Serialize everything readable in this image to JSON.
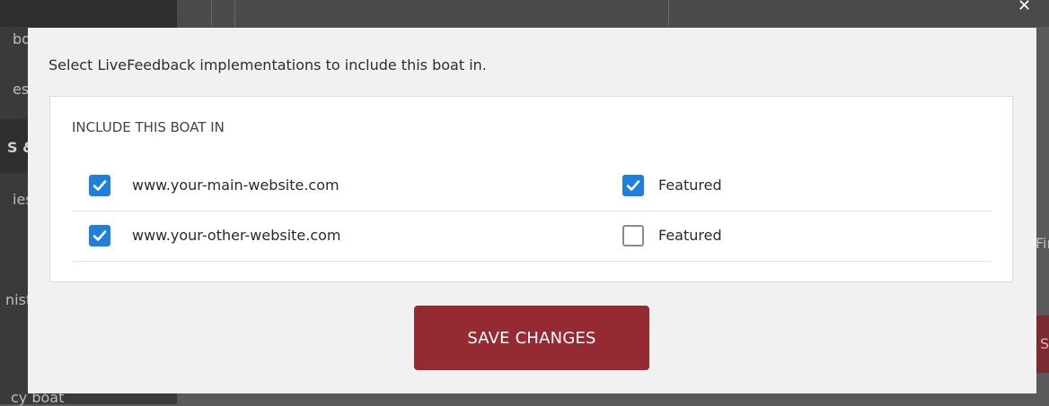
{
  "background": {
    "sidebar_fragments": [
      "bo",
      "es",
      "S &",
      "ies",
      "nist",
      "cy boat"
    ],
    "right_fragment": "Fir",
    "right_button_fragment": "S"
  },
  "modal": {
    "intro_text": "Select LiveFeedback implementations to include this boat in.",
    "section_title": "INCLUDE THIS BOAT IN",
    "rows": [
      {
        "site": "www.your-main-website.com",
        "site_checked": true,
        "featured_label": "Featured",
        "featured_checked": true
      },
      {
        "site": "www.your-other-website.com",
        "site_checked": true,
        "featured_label": "Featured",
        "featured_checked": false
      }
    ],
    "save_label": "SAVE CHANGES"
  },
  "colors": {
    "accent_checkbox": "#1e7fe0",
    "save_button": "#952a33",
    "modal_bg": "#f1f1f1"
  }
}
